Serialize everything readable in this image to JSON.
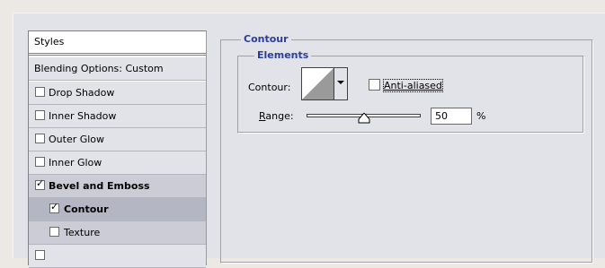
{
  "styles_panel": {
    "header": "Styles",
    "blending_options": "Blending Options: Custom",
    "items": [
      {
        "label": "Drop Shadow",
        "checked": false
      },
      {
        "label": "Inner Shadow",
        "checked": false
      },
      {
        "label": "Outer Glow",
        "checked": false
      },
      {
        "label": "Inner Glow",
        "checked": false
      },
      {
        "label": "Bevel and Emboss",
        "checked": true
      },
      {
        "label": "Contour",
        "checked": true
      },
      {
        "label": "Texture",
        "checked": false
      }
    ]
  },
  "contour_panel": {
    "title": "Contour",
    "elements_title": "Elements",
    "contour_label": "Contour:",
    "anti_aliased_label": "Anti-aliased",
    "anti_aliased_checked": false,
    "range_label_rest": "ange:",
    "range_label_mnemonic": "R",
    "range_value": "50",
    "range_unit": "%",
    "range_slider_percent": 50
  },
  "colors": {
    "group_title": "#2B3D9A",
    "selected_item": "#B4B6C4",
    "dialog_bg": "#E2E3E8"
  }
}
